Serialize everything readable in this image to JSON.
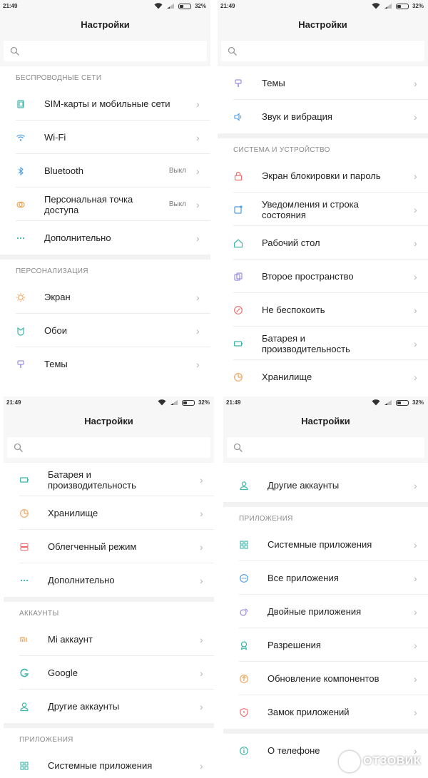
{
  "status": {
    "time": "21:49",
    "battery": "32%"
  },
  "header": {
    "title": "Настройки"
  },
  "search": {
    "placeholder": ""
  },
  "common": {
    "chevron": "›"
  },
  "panel_tl": {
    "section_wireless": "БЕСПРОВОДНЫЕ СЕТИ",
    "sim": "SIM-карты и мобильные сети",
    "wifi": "Wi-Fi",
    "bluetooth": "Bluetooth",
    "bluetooth_value": "Выкл",
    "hotspot_line1": "Персональная точка",
    "hotspot_line2": "доступа",
    "hotspot_value": "Выкл",
    "more": "Дополнительно",
    "section_personal": "ПЕРСОНАЛИЗАЦИЯ",
    "display": "Экран",
    "wallpaper": "Обои",
    "themes": "Темы"
  },
  "panel_tr": {
    "themes": "Темы",
    "sound": "Звук и вибрация",
    "section_system": "СИСТЕМА И УСТРОЙСТВО",
    "lockscreen": "Экран блокировки и пароль",
    "notif_line1": "Уведомления и строка",
    "notif_line2": "состояния",
    "desktop": "Рабочий стол",
    "second_space": "Второе пространство",
    "dnd": "Не беспокоить",
    "battery_line1": "Батарея и",
    "battery_line2": "производительность",
    "storage": "Хранилище"
  },
  "panel_bl": {
    "battery_line1": "Батарея и",
    "battery_line2": "производительность",
    "storage": "Хранилище",
    "lite_mode": "Облегченный режим",
    "more": "Дополнительно",
    "section_accounts": "АККАУНТЫ",
    "mi_account": "Mi аккаунт",
    "google": "Google",
    "other_accounts": "Другие аккаунты",
    "section_apps": "ПРИЛОЖЕНИЯ",
    "system_apps": "Системные приложения"
  },
  "panel_br": {
    "other_accounts": "Другие аккаунты",
    "section_apps": "ПРИЛОЖЕНИЯ",
    "system_apps": "Системные приложения",
    "all_apps": "Все приложения",
    "dual_apps": "Двойные приложения",
    "permissions": "Разрешения",
    "updates": "Обновление компонентов",
    "app_lock": "Замок приложений",
    "about": "О телефоне"
  },
  "watermark": {
    "text": "ОТЗОВИК"
  },
  "colors": {
    "accent_teal": "#3bb5a8",
    "accent_orange": "#f0a35b",
    "accent_purple": "#9b8ee0",
    "accent_red": "#ef6b6b",
    "accent_blue": "#4a9be8"
  }
}
